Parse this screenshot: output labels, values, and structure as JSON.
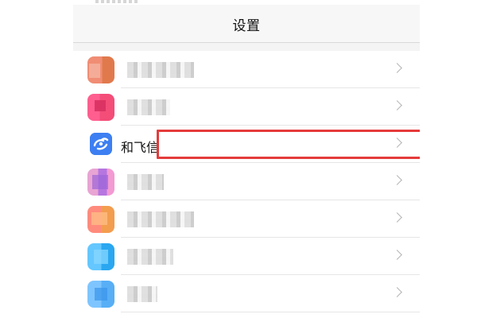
{
  "header": {
    "title": "设置"
  },
  "rows": [
    {
      "label": "",
      "icon": "app-icon",
      "obscured": true,
      "icon_color": "#e07a4d"
    },
    {
      "label": "",
      "icon": "app-icon",
      "obscured": true,
      "icon_color": "#f34d78"
    },
    {
      "label": "和飞信",
      "icon": "hefeixin-app-icon",
      "obscured": false,
      "icon_color": "#3d7ff2"
    },
    {
      "label": "",
      "icon": "app-icon",
      "obscured": true,
      "icon_color": "#b576e0"
    },
    {
      "label": "",
      "icon": "app-icon",
      "obscured": true,
      "icon_color": "#f39d4f"
    },
    {
      "label": "",
      "icon": "app-icon",
      "obscured": true,
      "icon_color": "#2aa7f0"
    },
    {
      "label": "",
      "icon": "app-icon",
      "obscured": true,
      "icon_color": "#58aff6"
    }
  ],
  "highlight": {
    "target": "和飞信",
    "color": "#e53b3b"
  },
  "chevron_icon": "chevron-right-icon"
}
